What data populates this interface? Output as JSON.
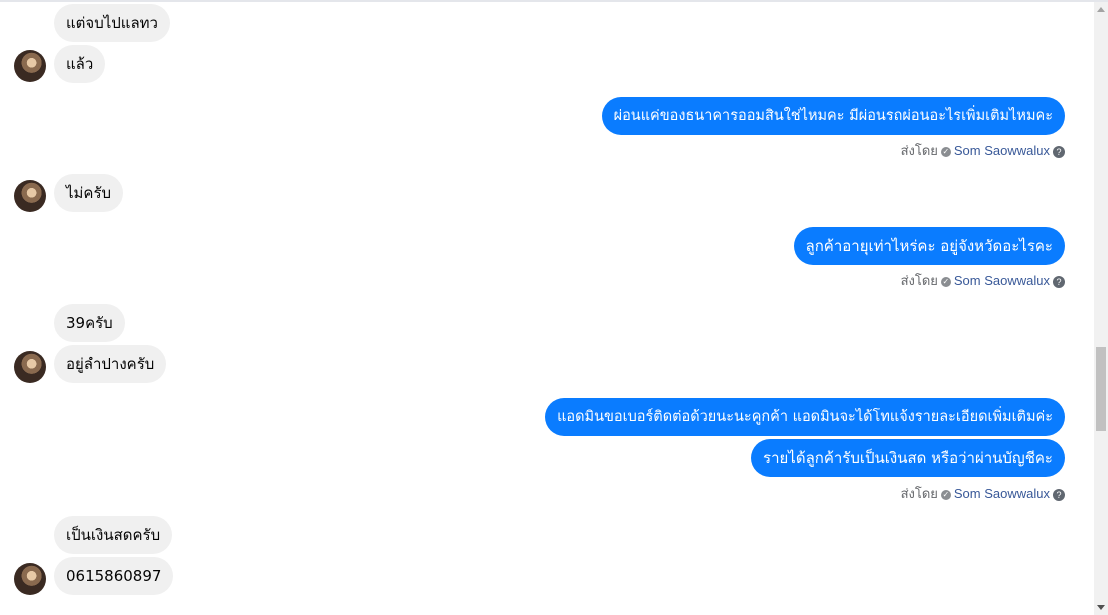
{
  "messages": {
    "m1": "แต่จบไปแลทว",
    "m2": "แล้ว",
    "m3": "ผ่อนแค่ของธนาคารออมสินใช่ไหมคะ มีผ่อนรถผ่อนอะไรเพิ่มเติมไหมคะ",
    "m4": "ไม่ครับ",
    "m5": "ลูกค้าอายุเท่าไหร่คะ อยู่จังหวัดอะไรคะ",
    "m6": "39ครับ",
    "m7": "อยู่ลำปางครับ",
    "m8": "แอดมินขอเบอร์ติดต่อด้วยนะนะคูกค้า แอดมินจะได้โทแจ้งรายละเอียดเพิ่มเติมค่ะ",
    "m9": "รายได้ลูกค้ารับเป็นเงินสด หรือว่าผ่านบัญชีคะ",
    "m10": "เป็นเงินสดครับ",
    "m11": "0615860897"
  },
  "sent_by": {
    "label": "ส่งโดย",
    "name": "Som Saowwalux",
    "help": "?"
  }
}
